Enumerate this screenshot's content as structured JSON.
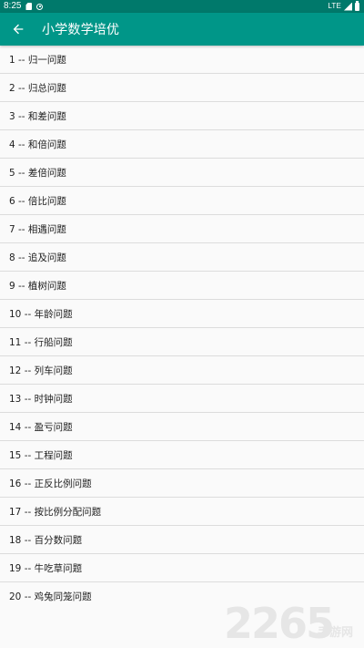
{
  "status_bar": {
    "time": "8:25",
    "network": "LTE",
    "icons": [
      "sd-card-icon",
      "sync-icon",
      "signal-icon",
      "battery-icon"
    ]
  },
  "app_bar": {
    "title": "小学数学培优",
    "back_icon": "arrow-left-icon",
    "background": "#009688",
    "status_background": "#00796b"
  },
  "list": {
    "items": [
      {
        "label": "1 -- 归一问题"
      },
      {
        "label": "2 -- 归总问题"
      },
      {
        "label": "3 -- 和差问题"
      },
      {
        "label": "4 -- 和倍问题"
      },
      {
        "label": "5 -- 差倍问题"
      },
      {
        "label": "6 -- 倍比问题"
      },
      {
        "label": "7 -- 相遇问题"
      },
      {
        "label": "8 -- 追及问题"
      },
      {
        "label": "9 -- 植树问题"
      },
      {
        "label": "10 -- 年龄问题"
      },
      {
        "label": "11 -- 行船问题"
      },
      {
        "label": "12 -- 列车问题"
      },
      {
        "label": "13 -- 时钟问题"
      },
      {
        "label": "14 -- 盈亏问题"
      },
      {
        "label": "15 -- 工程问题"
      },
      {
        "label": "16 -- 正反比例问题"
      },
      {
        "label": "17 -- 按比例分配问题"
      },
      {
        "label": "18 -- 百分数问题"
      },
      {
        "label": "19 -- 牛吃草问题"
      },
      {
        "label": "20 -- 鸡兔同笼问题"
      }
    ]
  },
  "watermark": {
    "digits": "2265",
    "suffix": "手游网",
    "color": "#e6e6e6"
  }
}
